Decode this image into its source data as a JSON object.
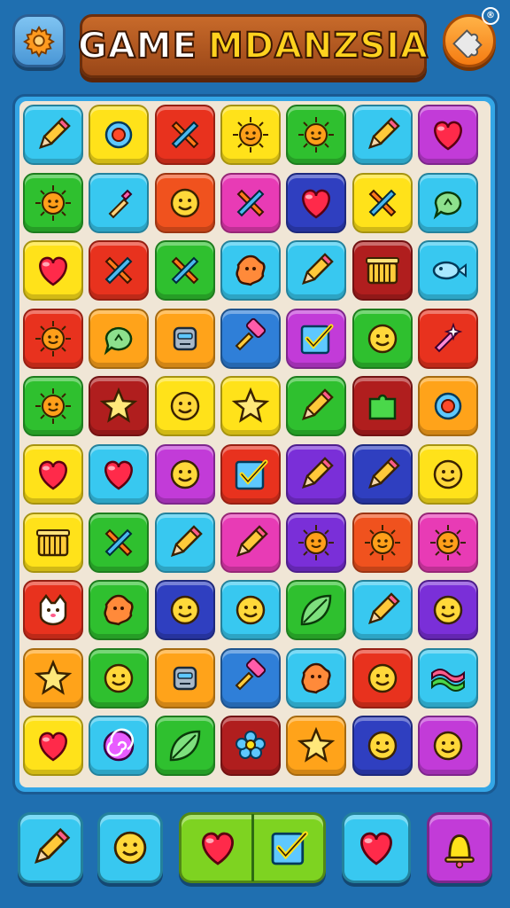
{
  "header": {
    "title_part1": "GAME",
    "title_part2": "MDANZSIA",
    "registered_mark": "®",
    "left_button_icon": "gear-icon",
    "right_button_icon": "puzzle-icon"
  },
  "board": {
    "rows": 10,
    "cols": 7,
    "tiles": [
      [
        {
          "color": "#38c8f0",
          "icon": "pencil"
        },
        {
          "color": "#ffe21a",
          "icon": "gem"
        },
        {
          "color": "#e8321e",
          "icon": "cross"
        },
        {
          "color": "#ffe21a",
          "icon": "sun"
        },
        {
          "color": "#2fc02f",
          "icon": "sun"
        },
        {
          "color": "#38c8f0",
          "icon": "pencil"
        },
        {
          "color": "#c23bd8",
          "icon": "heart"
        }
      ],
      [
        {
          "color": "#2fc02f",
          "icon": "sun"
        },
        {
          "color": "#38c8f0",
          "icon": "bottle"
        },
        {
          "color": "#f0521e",
          "icon": "face"
        },
        {
          "color": "#e83bb5",
          "icon": "cross"
        },
        {
          "color": "#2f3fc0",
          "icon": "heart"
        },
        {
          "color": "#ffe21a",
          "icon": "cross"
        },
        {
          "color": "#38c8f0",
          "icon": "bubble"
        }
      ],
      [
        {
          "color": "#ffe21a",
          "icon": "heart"
        },
        {
          "color": "#e8321e",
          "icon": "cross"
        },
        {
          "color": "#2fc02f",
          "icon": "cross"
        },
        {
          "color": "#38c8f0",
          "icon": "blob"
        },
        {
          "color": "#38c8f0",
          "icon": "pencil"
        },
        {
          "color": "#b01e1e",
          "icon": "basket"
        },
        {
          "color": "#38c8f0",
          "icon": "fish"
        }
      ],
      [
        {
          "color": "#e8321e",
          "icon": "sun"
        },
        {
          "color": "#ffa31a",
          "icon": "bubble"
        },
        {
          "color": "#ffa31a",
          "icon": "robot"
        },
        {
          "color": "#2f7fd8",
          "icon": "hammer"
        },
        {
          "color": "#c23bd8",
          "icon": "check"
        },
        {
          "color": "#2fc02f",
          "icon": "face"
        },
        {
          "color": "#e8321e",
          "icon": "wand"
        }
      ],
      [
        {
          "color": "#2fc02f",
          "icon": "sun"
        },
        {
          "color": "#b01e1e",
          "icon": "star"
        },
        {
          "color": "#ffe21a",
          "icon": "face"
        },
        {
          "color": "#ffe21a",
          "icon": "star"
        },
        {
          "color": "#2fc02f",
          "icon": "pencil"
        },
        {
          "color": "#b01e1e",
          "icon": "puzzle"
        },
        {
          "color": "#ffa31a",
          "icon": "gem"
        }
      ],
      [
        {
          "color": "#ffe21a",
          "icon": "heart"
        },
        {
          "color": "#38c8f0",
          "icon": "heart"
        },
        {
          "color": "#c23bd8",
          "icon": "face"
        },
        {
          "color": "#e8321e",
          "icon": "check"
        },
        {
          "color": "#7a2fd8",
          "icon": "pencil"
        },
        {
          "color": "#2f3fc0",
          "icon": "pencil"
        },
        {
          "color": "#ffe21a",
          "icon": "face"
        }
      ],
      [
        {
          "color": "#ffe21a",
          "icon": "basket"
        },
        {
          "color": "#2fc02f",
          "icon": "cross"
        },
        {
          "color": "#38c8f0",
          "icon": "pencil"
        },
        {
          "color": "#e83bb5",
          "icon": "pencil"
        },
        {
          "color": "#7a2fd8",
          "icon": "sun"
        },
        {
          "color": "#f0521e",
          "icon": "sun"
        },
        {
          "color": "#e83bb5",
          "icon": "sun"
        }
      ],
      [
        {
          "color": "#e8321e",
          "icon": "cat"
        },
        {
          "color": "#2fc02f",
          "icon": "blob"
        },
        {
          "color": "#2f3fc0",
          "icon": "face"
        },
        {
          "color": "#38c8f0",
          "icon": "face"
        },
        {
          "color": "#2fc02f",
          "icon": "leaf"
        },
        {
          "color": "#38c8f0",
          "icon": "pencil"
        },
        {
          "color": "#7a2fd8",
          "icon": "face"
        }
      ],
      [
        {
          "color": "#ffa31a",
          "icon": "star"
        },
        {
          "color": "#2fc02f",
          "icon": "face"
        },
        {
          "color": "#ffa31a",
          "icon": "robot"
        },
        {
          "color": "#2f7fd8",
          "icon": "hammer"
        },
        {
          "color": "#38c8f0",
          "icon": "blob"
        },
        {
          "color": "#e8321e",
          "icon": "face"
        },
        {
          "color": "#38c8f0",
          "icon": "wave"
        }
      ],
      [
        {
          "color": "#ffe21a",
          "icon": "heart"
        },
        {
          "color": "#38c8f0",
          "icon": "swirl"
        },
        {
          "color": "#2fc02f",
          "icon": "leaf"
        },
        {
          "color": "#b01e1e",
          "icon": "flower"
        },
        {
          "color": "#ffa31a",
          "icon": "star"
        },
        {
          "color": "#2f3fc0",
          "icon": "face"
        },
        {
          "color": "#c23bd8",
          "icon": "face"
        }
      ]
    ]
  },
  "powerups": [
    {
      "name": "pencil-powerup",
      "color": "#38c8f0",
      "icon": "pencil"
    },
    {
      "name": "face-powerup",
      "color": "#38c8f0",
      "icon": "face"
    },
    {
      "name": "heart-powerup",
      "color": "#7ed321",
      "icon": "heart"
    },
    {
      "name": "check-powerup",
      "color": "#7ed321",
      "icon": "check"
    },
    {
      "name": "rainbow-heart-powerup",
      "color": "#38c8f0",
      "icon": "heart"
    },
    {
      "name": "bell-powerup",
      "color": "#c23bd8",
      "icon": "bell"
    }
  ],
  "colors": {
    "background": "#1f6fb0",
    "board_frame": "#34a6e6",
    "board_bg": "#f0e6d6",
    "title_plate": "#b35a22",
    "title_accent": "#ffd21f"
  }
}
